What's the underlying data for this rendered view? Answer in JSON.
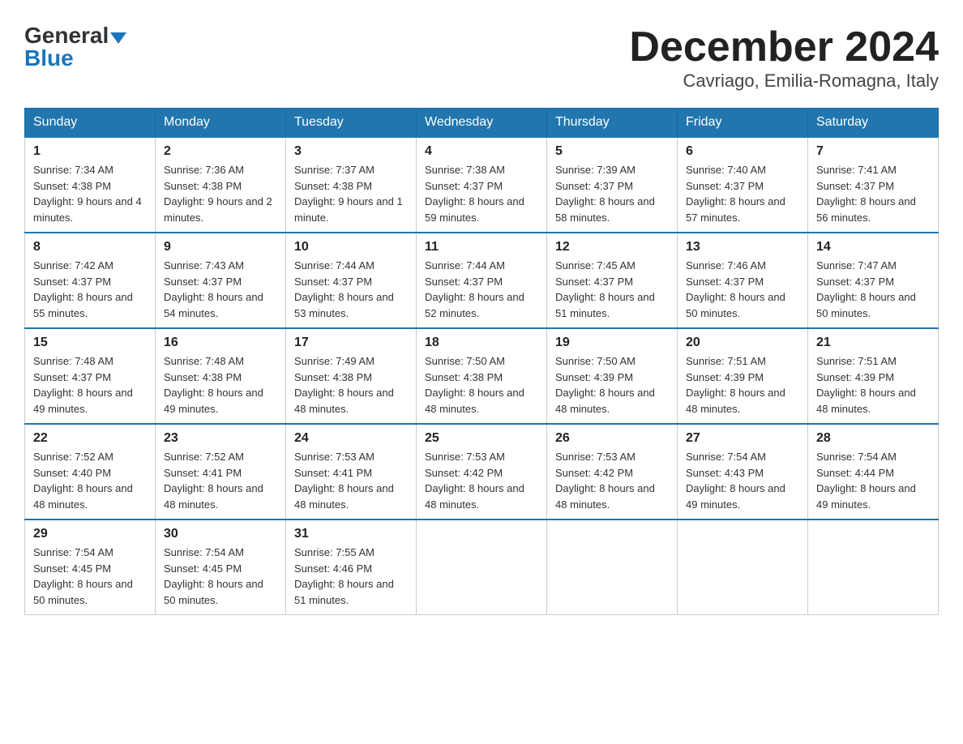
{
  "header": {
    "logo_general": "General",
    "logo_blue": "Blue",
    "month_year": "December 2024",
    "location": "Cavriago, Emilia-Romagna, Italy"
  },
  "days_of_week": [
    "Sunday",
    "Monday",
    "Tuesday",
    "Wednesday",
    "Thursday",
    "Friday",
    "Saturday"
  ],
  "weeks": [
    [
      {
        "day": "1",
        "sunrise": "7:34 AM",
        "sunset": "4:38 PM",
        "daylight": "9 hours and 4 minutes."
      },
      {
        "day": "2",
        "sunrise": "7:36 AM",
        "sunset": "4:38 PM",
        "daylight": "9 hours and 2 minutes."
      },
      {
        "day": "3",
        "sunrise": "7:37 AM",
        "sunset": "4:38 PM",
        "daylight": "9 hours and 1 minute."
      },
      {
        "day": "4",
        "sunrise": "7:38 AM",
        "sunset": "4:37 PM",
        "daylight": "8 hours and 59 minutes."
      },
      {
        "day": "5",
        "sunrise": "7:39 AM",
        "sunset": "4:37 PM",
        "daylight": "8 hours and 58 minutes."
      },
      {
        "day": "6",
        "sunrise": "7:40 AM",
        "sunset": "4:37 PM",
        "daylight": "8 hours and 57 minutes."
      },
      {
        "day": "7",
        "sunrise": "7:41 AM",
        "sunset": "4:37 PM",
        "daylight": "8 hours and 56 minutes."
      }
    ],
    [
      {
        "day": "8",
        "sunrise": "7:42 AM",
        "sunset": "4:37 PM",
        "daylight": "8 hours and 55 minutes."
      },
      {
        "day": "9",
        "sunrise": "7:43 AM",
        "sunset": "4:37 PM",
        "daylight": "8 hours and 54 minutes."
      },
      {
        "day": "10",
        "sunrise": "7:44 AM",
        "sunset": "4:37 PM",
        "daylight": "8 hours and 53 minutes."
      },
      {
        "day": "11",
        "sunrise": "7:44 AM",
        "sunset": "4:37 PM",
        "daylight": "8 hours and 52 minutes."
      },
      {
        "day": "12",
        "sunrise": "7:45 AM",
        "sunset": "4:37 PM",
        "daylight": "8 hours and 51 minutes."
      },
      {
        "day": "13",
        "sunrise": "7:46 AM",
        "sunset": "4:37 PM",
        "daylight": "8 hours and 50 minutes."
      },
      {
        "day": "14",
        "sunrise": "7:47 AM",
        "sunset": "4:37 PM",
        "daylight": "8 hours and 50 minutes."
      }
    ],
    [
      {
        "day": "15",
        "sunrise": "7:48 AM",
        "sunset": "4:37 PM",
        "daylight": "8 hours and 49 minutes."
      },
      {
        "day": "16",
        "sunrise": "7:48 AM",
        "sunset": "4:38 PM",
        "daylight": "8 hours and 49 minutes."
      },
      {
        "day": "17",
        "sunrise": "7:49 AM",
        "sunset": "4:38 PM",
        "daylight": "8 hours and 48 minutes."
      },
      {
        "day": "18",
        "sunrise": "7:50 AM",
        "sunset": "4:38 PM",
        "daylight": "8 hours and 48 minutes."
      },
      {
        "day": "19",
        "sunrise": "7:50 AM",
        "sunset": "4:39 PM",
        "daylight": "8 hours and 48 minutes."
      },
      {
        "day": "20",
        "sunrise": "7:51 AM",
        "sunset": "4:39 PM",
        "daylight": "8 hours and 48 minutes."
      },
      {
        "day": "21",
        "sunrise": "7:51 AM",
        "sunset": "4:39 PM",
        "daylight": "8 hours and 48 minutes."
      }
    ],
    [
      {
        "day": "22",
        "sunrise": "7:52 AM",
        "sunset": "4:40 PM",
        "daylight": "8 hours and 48 minutes."
      },
      {
        "day": "23",
        "sunrise": "7:52 AM",
        "sunset": "4:41 PM",
        "daylight": "8 hours and 48 minutes."
      },
      {
        "day": "24",
        "sunrise": "7:53 AM",
        "sunset": "4:41 PM",
        "daylight": "8 hours and 48 minutes."
      },
      {
        "day": "25",
        "sunrise": "7:53 AM",
        "sunset": "4:42 PM",
        "daylight": "8 hours and 48 minutes."
      },
      {
        "day": "26",
        "sunrise": "7:53 AM",
        "sunset": "4:42 PM",
        "daylight": "8 hours and 48 minutes."
      },
      {
        "day": "27",
        "sunrise": "7:54 AM",
        "sunset": "4:43 PM",
        "daylight": "8 hours and 49 minutes."
      },
      {
        "day": "28",
        "sunrise": "7:54 AM",
        "sunset": "4:44 PM",
        "daylight": "8 hours and 49 minutes."
      }
    ],
    [
      {
        "day": "29",
        "sunrise": "7:54 AM",
        "sunset": "4:45 PM",
        "daylight": "8 hours and 50 minutes."
      },
      {
        "day": "30",
        "sunrise": "7:54 AM",
        "sunset": "4:45 PM",
        "daylight": "8 hours and 50 minutes."
      },
      {
        "day": "31",
        "sunrise": "7:55 AM",
        "sunset": "4:46 PM",
        "daylight": "8 hours and 51 minutes."
      },
      null,
      null,
      null,
      null
    ]
  ]
}
